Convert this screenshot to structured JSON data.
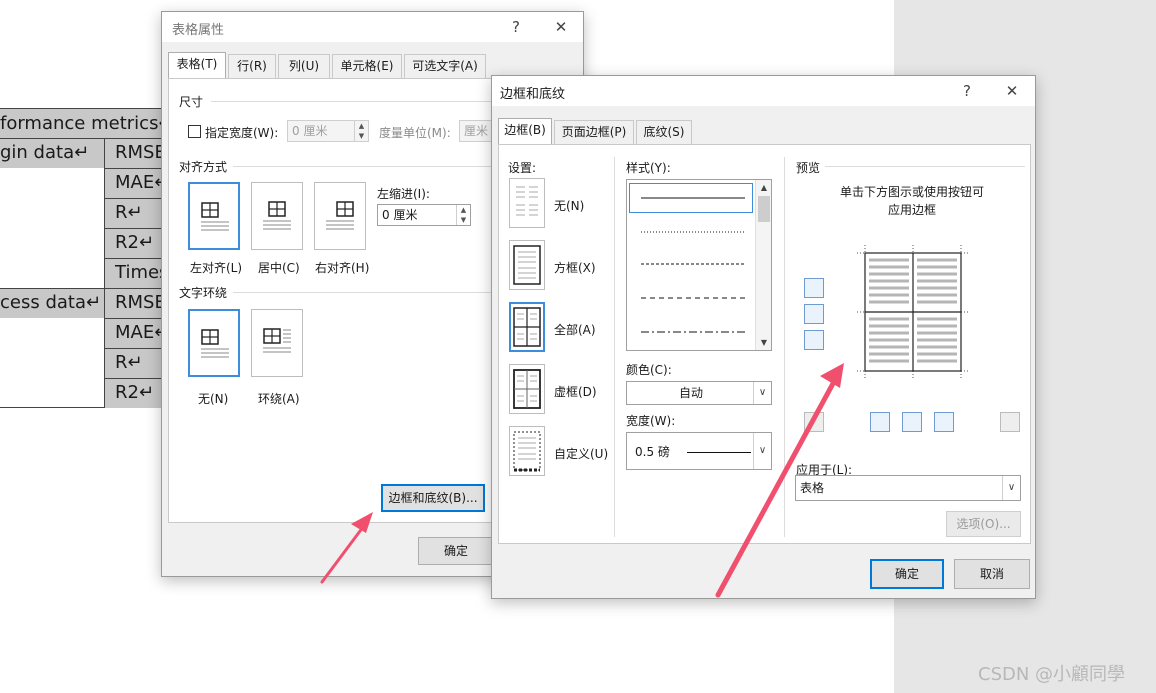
{
  "doc": {
    "cells": [
      "formance metrics↵",
      "gin data↵",
      "RMSE",
      "MAE↵",
      "R↵",
      "R2↵",
      "Times",
      "cess data↵",
      "RMSE",
      "MAE↵",
      "R↵",
      "R2↵"
    ]
  },
  "watermark": "CSDN @小顧同學",
  "table_props": {
    "title": "表格属性",
    "help": "?",
    "close": "✕",
    "tabs": [
      "表格(T)",
      "行(R)",
      "列(U)",
      "单元格(E)",
      "可选文字(A)"
    ],
    "size_section": "尺寸",
    "specify_width": "指定宽度(W):",
    "width_value": "0 厘米",
    "measure_unit": "度量单位(M):",
    "unit_value": "厘米",
    "align_section": "对齐方式",
    "align_options": [
      "左对齐(L)",
      "居中(C)",
      "右对齐(H)"
    ],
    "indent_label": "左缩进(I):",
    "indent_value": "0 厘米",
    "wrap_section": "文字环绕",
    "wrap_options": [
      "无(N)",
      "环绕(A)"
    ],
    "borders_button": "边框和底纹(B)...",
    "ok": "确定"
  },
  "borders": {
    "title": "边框和底纹",
    "help": "?",
    "close": "✕",
    "tabs": [
      "边框(B)",
      "页面边框(P)",
      "底纹(S)"
    ],
    "setting_label": "设置:",
    "settings": [
      "无(N)",
      "方框(X)",
      "全部(A)",
      "虚框(D)",
      "自定义(U)"
    ],
    "style_label": "样式(Y):",
    "color_label": "颜色(C):",
    "color_value": "自动",
    "width_label": "宽度(W):",
    "width_value": "0.5 磅",
    "preview_label": "预览",
    "preview_hint_1": "单击下方图示或使用按钮可",
    "preview_hint_2": "应用边框",
    "apply_label": "应用于(L):",
    "apply_value": "表格",
    "options": "选项(O)...",
    "ok": "确定",
    "cancel": "取消"
  },
  "icons": {
    "spin": "spin-arrows-icon",
    "dropdown": "chevron-down-icon",
    "arrow": "red-arrow-annotation"
  },
  "colors": {
    "accent": "#0078d7",
    "selected_border": "#3c8ddc",
    "arrow": "#f0506e"
  }
}
